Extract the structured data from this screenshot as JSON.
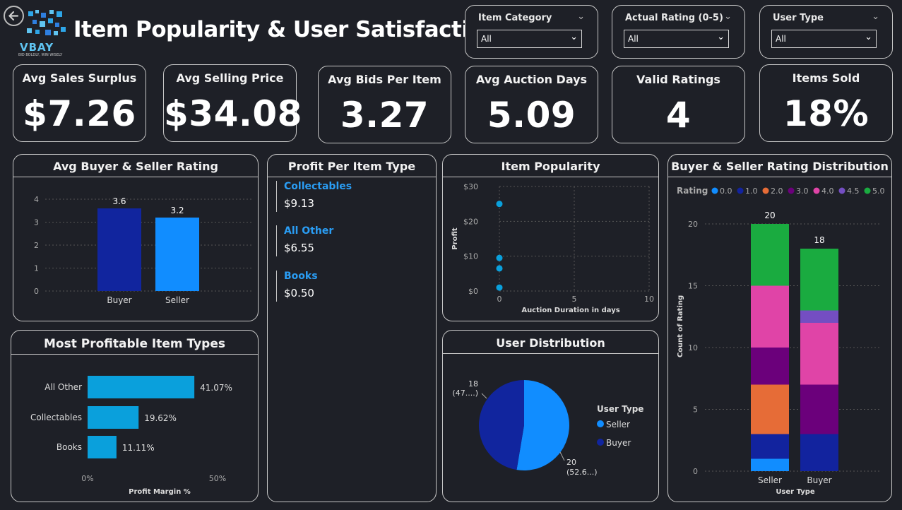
{
  "header": {
    "back_icon": "back-arrow-icon",
    "logo_text": "VBAY",
    "logo_tagline": "BID BOLDLY, WIN WISELY",
    "title": "Item Popularity & User Satisfaction"
  },
  "filters": [
    {
      "label": "Item Category",
      "value": "All"
    },
    {
      "label": "Actual Rating (0-5)",
      "value": "All"
    },
    {
      "label": "User Type",
      "value": "All"
    }
  ],
  "kpis": [
    {
      "label": "Avg Sales Surplus",
      "value": "$7.26"
    },
    {
      "label": "Avg Selling Price",
      "value": "$34.08"
    },
    {
      "label": "Avg Bids Per Item",
      "value": "3.27"
    },
    {
      "label": "Avg Auction Days",
      "value": "5.09"
    },
    {
      "label": "Valid Ratings",
      "value": "4"
    },
    {
      "label": "Items Sold",
      "value": "18%"
    }
  ],
  "colors": {
    "buyer": "#11259e",
    "seller": "#118dff",
    "bar": "#0aa0dc",
    "rating_0": "#118dff",
    "rating_1": "#12239e",
    "rating_2": "#e66c37",
    "rating_3": "#6b007b",
    "rating_4": "#e044a7",
    "rating_4_5": "#744ec2",
    "rating_5": "#1aab40"
  },
  "panels": {
    "avg_rating_title": "Avg Buyer & Seller Rating",
    "profit_per_type_title": "Profit Per Item Type",
    "item_popularity_title": "Item Popularity",
    "rating_dist_title": "Buyer & Seller Rating Distribution",
    "most_profitable_title": "Most Profitable Item Types",
    "user_dist_title": "User Distribution"
  },
  "profit_per_type": [
    {
      "category": "Collectables",
      "value": "$9.13"
    },
    {
      "category": "All Other",
      "value": "$6.55"
    },
    {
      "category": "Books",
      "value": "$0.50"
    }
  ],
  "chart_data": [
    {
      "id": "avg_rating",
      "type": "bar",
      "categories": [
        "Buyer",
        "Seller"
      ],
      "values": [
        3.6,
        3.2
      ],
      "labels": [
        "3.6",
        "3.2"
      ],
      "ylim": [
        0,
        4
      ],
      "yticks": [
        "0",
        "1",
        "2",
        "3",
        "4"
      ],
      "grid": true
    },
    {
      "id": "item_popularity",
      "type": "scatter",
      "xlabel": "Auction Duration in days",
      "ylabel": "Profit",
      "x": [
        0,
        0,
        0,
        0
      ],
      "y": [
        25,
        9.5,
        6.5,
        1
      ],
      "xlim": [
        0,
        10
      ],
      "ylim": [
        0,
        30
      ],
      "xticks": [
        "0",
        "5",
        "10"
      ],
      "yticks": [
        "$0",
        "$10",
        "$20",
        "$30"
      ],
      "grid": true
    },
    {
      "id": "most_profitable",
      "type": "bar",
      "orientation": "horizontal",
      "categories": [
        "All Other",
        "Collectables",
        "Books"
      ],
      "values": [
        41.07,
        19.62,
        11.11
      ],
      "labels": [
        "41.07%",
        "19.62%",
        "11.11%"
      ],
      "xlabel": "Profit Margin %",
      "xlim": [
        0,
        50
      ],
      "xticks": [
        "0%",
        "50%"
      ]
    },
    {
      "id": "user_distribution",
      "type": "pie",
      "legend_title": "User Type",
      "legend_position": "right",
      "slices": [
        {
          "name": "Seller",
          "value": 20,
          "label_top": "20",
          "label_bottom": "(52.6...)"
        },
        {
          "name": "Buyer",
          "value": 18,
          "label_top": "18",
          "label_bottom": "(47....)"
        }
      ]
    },
    {
      "id": "rating_distribution",
      "type": "bar",
      "stacked": true,
      "legend_title": "Rating",
      "legend_position": "top",
      "legend": [
        "0.0",
        "1.0",
        "2.0",
        "3.0",
        "4.0",
        "4.5",
        "5.0"
      ],
      "xlabel": "User Type",
      "ylabel": "Count of Rating",
      "categories": [
        "Seller",
        "Buyer"
      ],
      "totals": [
        "20",
        "18"
      ],
      "ylim": [
        0,
        20
      ],
      "yticks": [
        "0",
        "5",
        "10",
        "15",
        "20"
      ],
      "grid": true,
      "series": [
        {
          "name": "0.0",
          "values": [
            1,
            0
          ]
        },
        {
          "name": "1.0",
          "values": [
            2,
            3
          ]
        },
        {
          "name": "2.0",
          "values": [
            4,
            0
          ]
        },
        {
          "name": "3.0",
          "values": [
            3,
            4
          ]
        },
        {
          "name": "4.0",
          "values": [
            5,
            5
          ]
        },
        {
          "name": "4.5",
          "values": [
            0,
            1
          ]
        },
        {
          "name": "5.0",
          "values": [
            5,
            5
          ]
        }
      ]
    }
  ]
}
